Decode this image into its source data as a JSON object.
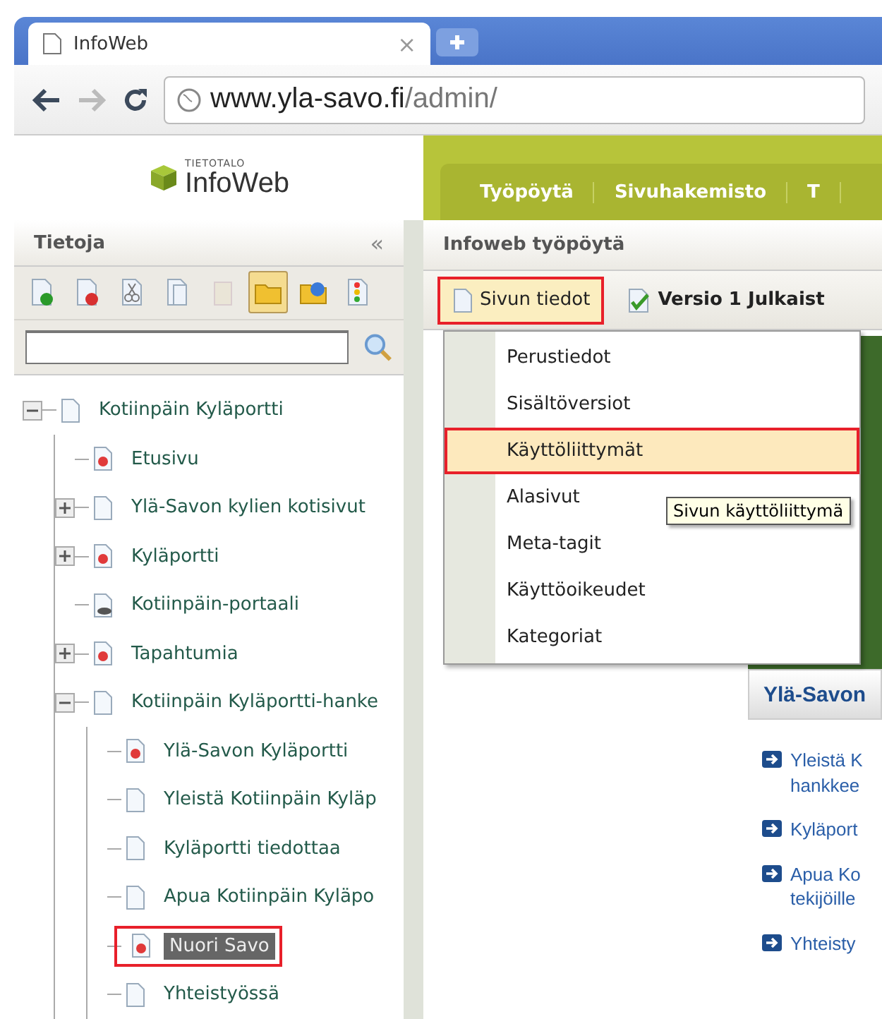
{
  "browser": {
    "tab": {
      "title": "InfoWeb",
      "close": "×"
    },
    "address": {
      "host": "www.yla-savo.fi",
      "path": "/admin/"
    }
  },
  "app": {
    "logo": {
      "brand": "TIETOTALO",
      "name": "InfoWeb"
    },
    "nav": [
      {
        "label": "Työpöytä",
        "selected": false
      },
      {
        "label": "Sivuhakemisto",
        "selected": false
      },
      {
        "label": "T",
        "selected": false
      }
    ]
  },
  "left_panel": {
    "title": "Tietoja",
    "collapse": "«",
    "toolbar": [
      {
        "kind": "new-page",
        "disabled": false,
        "selected": false
      },
      {
        "kind": "delete-page",
        "disabled": false,
        "selected": false
      },
      {
        "kind": "cut",
        "disabled": false,
        "selected": false
      },
      {
        "kind": "copy",
        "disabled": false,
        "selected": false
      },
      {
        "kind": "paste",
        "disabled": true,
        "selected": false
      },
      {
        "kind": "folder",
        "disabled": false,
        "selected": true
      },
      {
        "kind": "globe-folder",
        "disabled": false,
        "selected": false
      },
      {
        "kind": "status",
        "disabled": false,
        "selected": false
      }
    ],
    "tree": [
      {
        "label": "Kotiinpäin Kyläportti",
        "kind": "page",
        "expanded": true,
        "selected": false,
        "annotated": false,
        "children": [
          {
            "label": "Etusivu",
            "kind": "page-dot",
            "selected": false,
            "annotated": false
          },
          {
            "label": "Ylä-Savon kylien kotisivut",
            "kind": "page",
            "expanded": false,
            "selected": false,
            "annotated": false
          },
          {
            "label": "Kyläportti",
            "kind": "page-dot",
            "expanded": false,
            "selected": false,
            "annotated": false
          },
          {
            "label": "Kotiinpäin-portaali",
            "kind": "portal",
            "selected": false,
            "annotated": false
          },
          {
            "label": "Tapahtumia",
            "kind": "page-dot",
            "expanded": false,
            "selected": false,
            "annotated": false
          },
          {
            "label": "Kotiinpäin Kyläportti-hanke",
            "kind": "page",
            "expanded": true,
            "selected": false,
            "annotated": false,
            "children": [
              {
                "label": "Ylä-Savon Kyläportti",
                "kind": "page-dot",
                "selected": false,
                "annotated": false
              },
              {
                "label": "Yleistä Kotiinpäin Kyläp",
                "kind": "page",
                "selected": false,
                "annotated": false
              },
              {
                "label": "Kyläportti tiedottaa",
                "kind": "page",
                "selected": false,
                "annotated": false
              },
              {
                "label": "Apua Kotiinpäin Kyläpo",
                "kind": "page",
                "selected": false,
                "annotated": false
              },
              {
                "label": "Nuori Savo",
                "kind": "page-dot",
                "selected": true,
                "annotated": true
              },
              {
                "label": "Yhteistyössä",
                "kind": "page",
                "selected": false,
                "annotated": false
              }
            ]
          }
        ]
      }
    ]
  },
  "right_panel": {
    "title": "Infoweb työpöytä",
    "toolbar": [
      {
        "label": "Sivun tiedot",
        "kind": "page-info",
        "open": true,
        "annotated": true
      },
      {
        "label": "Versio 1 Julkaist",
        "kind": "version",
        "open": false,
        "annotated": false
      }
    ],
    "menu": [
      {
        "label": "Perustiedot",
        "selected": false,
        "annotated": false
      },
      {
        "label": "Sisältöversiot",
        "selected": false,
        "annotated": false
      },
      {
        "label": "Käyttöliittymät",
        "selected": true,
        "annotated": true
      },
      {
        "label": "Alasivut",
        "selected": false,
        "annotated": false
      },
      {
        "label": "Meta-tagit",
        "selected": false,
        "annotated": false
      },
      {
        "label": "Käyttöoikeudet",
        "selected": false,
        "annotated": false
      },
      {
        "label": "Kategoriat",
        "selected": false,
        "annotated": false
      }
    ],
    "tooltip": "Sivun käyttöliittymä",
    "preview": {
      "tab": "Ylä-Savon",
      "links": [
        {
          "lines": [
            "Yleistä K",
            "hankkee"
          ]
        },
        {
          "lines": [
            "Kyläport"
          ]
        },
        {
          "lines": [
            "Apua Ko",
            "tekijöille"
          ]
        },
        {
          "lines": [
            "Yhteisty"
          ]
        }
      ]
    }
  }
}
